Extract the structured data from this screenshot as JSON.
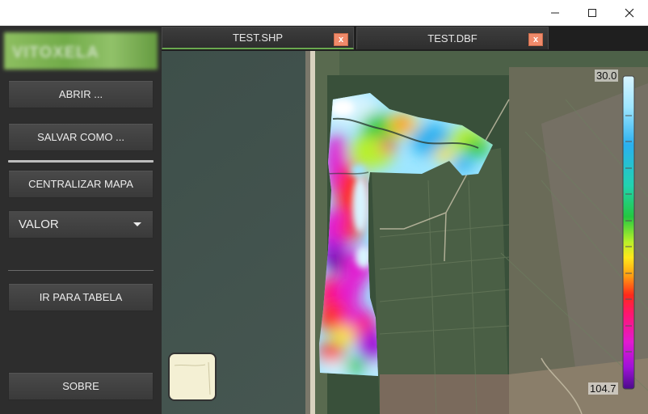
{
  "window": {
    "minimize_icon": "minimize-icon",
    "maximize_icon": "maximize-icon",
    "close_icon": "close-icon"
  },
  "sidebar": {
    "logo_text": "VITOXELA",
    "open_button": "ABRIR ...",
    "save_as_button": "SALVAR COMO ...",
    "center_map_button": "CENTRALIZAR MAPA",
    "value_select": "VALOR",
    "go_to_table_button": "IR PARA TABELA",
    "about_button": "SOBRE"
  },
  "tabs": [
    {
      "label": "TEST.SHP",
      "close": "x",
      "active": true
    },
    {
      "label": "TEST.DBF",
      "close": "x",
      "active": false
    }
  ],
  "legend": {
    "max_label": "30.0",
    "min_label": "104.7"
  },
  "colors": {
    "accent": "#6aa84f",
    "tab_close": "#f08a6a",
    "sidebar_bg": "#2d2d2d"
  }
}
